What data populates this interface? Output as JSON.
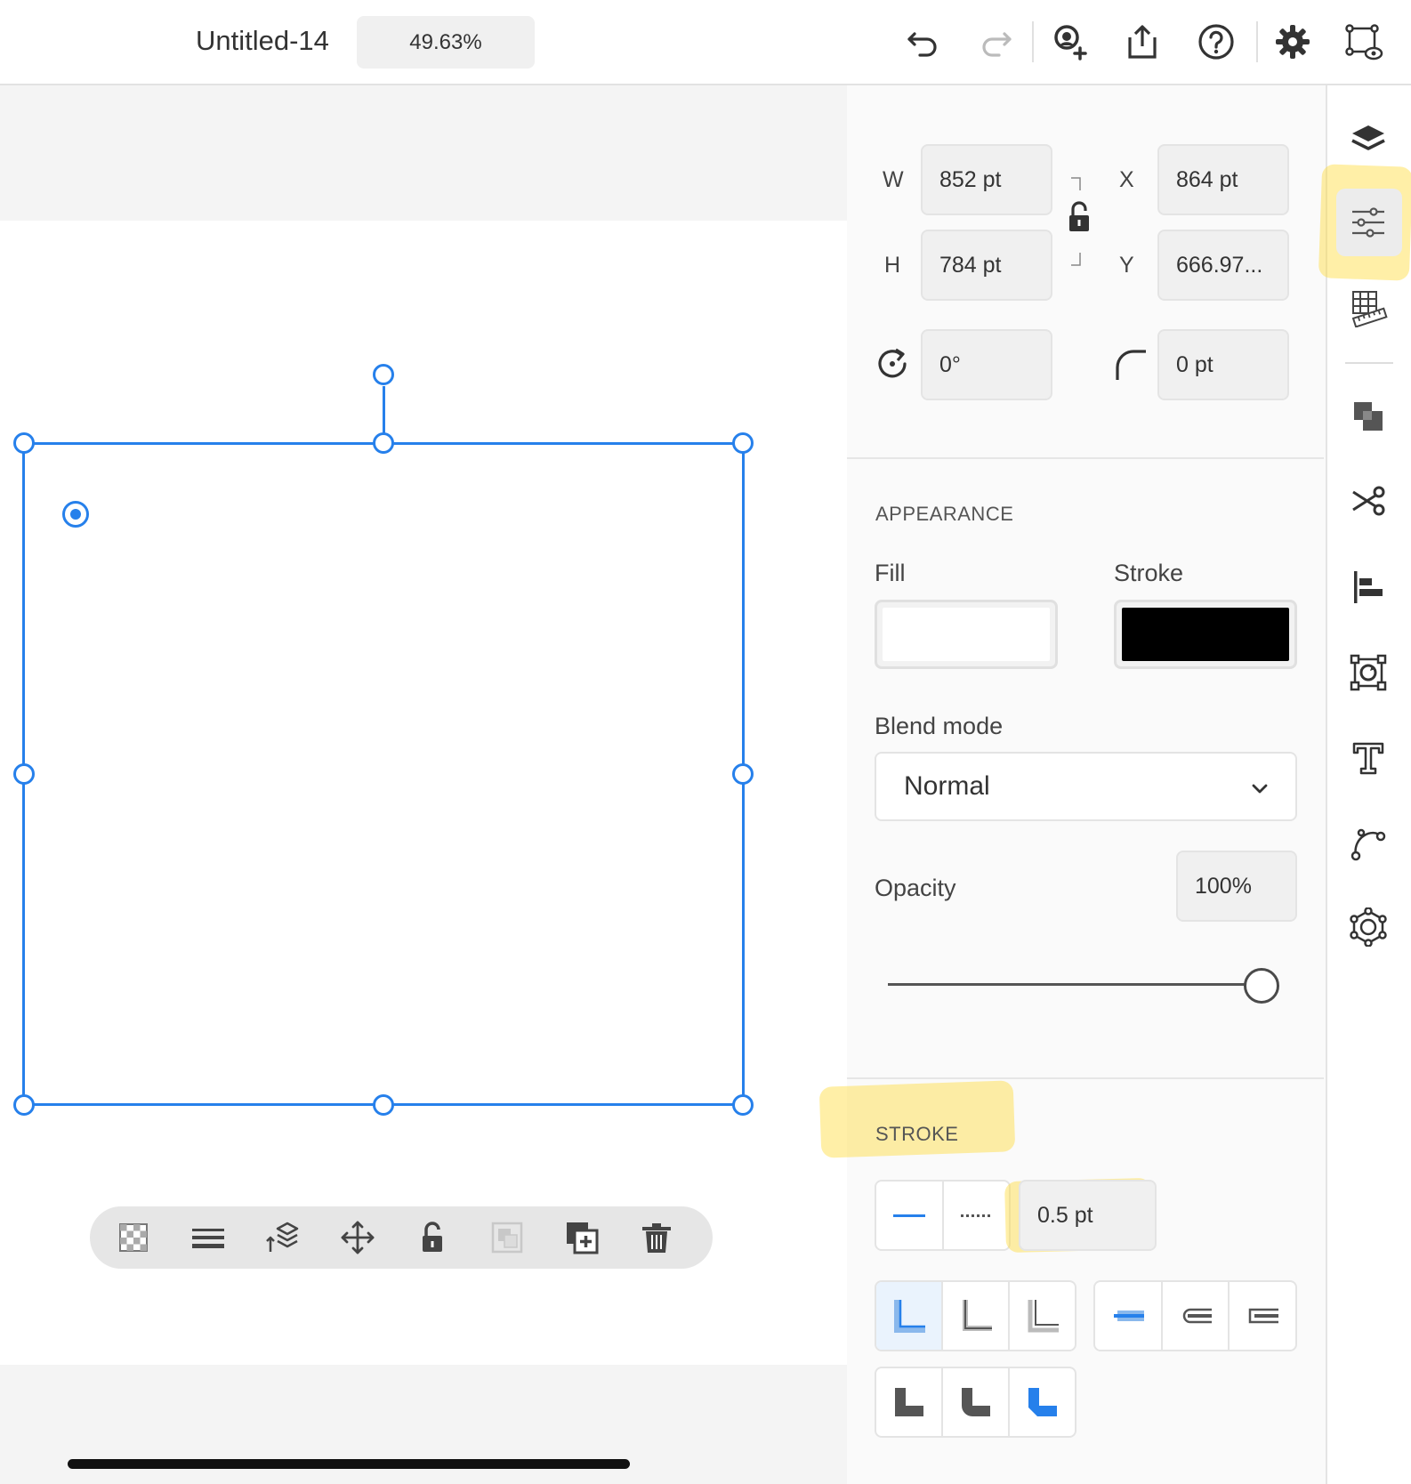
{
  "app": {
    "document_title": "Untitled-14",
    "zoom": "49.63%"
  },
  "toolbar": {
    "icons": [
      "undo-icon",
      "redo-icon",
      "invite-icon",
      "share-icon",
      "help-icon",
      "settings-icon",
      "preview-icon"
    ]
  },
  "transform": {
    "w_label": "W",
    "w_value": "852 pt",
    "h_label": "H",
    "h_value": "784 pt",
    "x_label": "X",
    "x_value": "864 pt",
    "y_label": "Y",
    "y_value": "666.97...",
    "rotation_value": "0°",
    "corner_radius_value": "0 pt"
  },
  "appearance": {
    "section_title": "APPEARANCE",
    "fill_label": "Fill",
    "fill_color": "#ffffff",
    "stroke_label": "Stroke",
    "stroke_color": "#000000",
    "blend_label": "Blend mode",
    "blend_value": "Normal",
    "opacity_label": "Opacity",
    "opacity_value": "100%",
    "opacity_level": 1.0
  },
  "stroke": {
    "section_title": "STROKE",
    "weight_value": "0.5 pt"
  },
  "colors": {
    "accent": "#2680eb",
    "highlight": "#ffe03c"
  }
}
